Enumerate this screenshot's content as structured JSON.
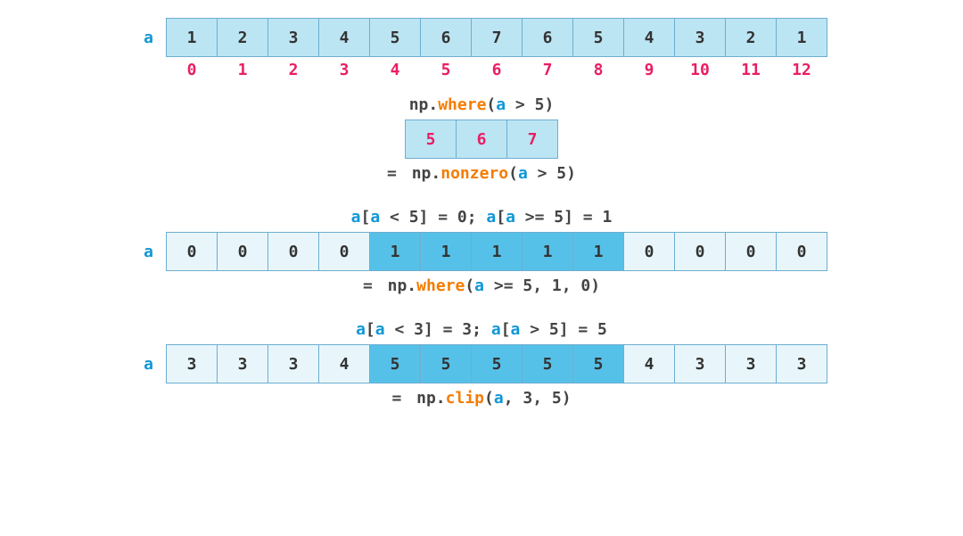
{
  "chart_data": [
    {
      "type": "table",
      "name": "numpy-where-single-arg",
      "title": "np.where(a > 5)",
      "equivalent": "= np.nonzero(a > 5)",
      "input_array": [
        1,
        2,
        3,
        4,
        5,
        6,
        7,
        6,
        5,
        4,
        3,
        2,
        1
      ],
      "indices": [
        0,
        1,
        2,
        3,
        4,
        5,
        6,
        7,
        8,
        9,
        10,
        11,
        12
      ],
      "result_indices": [
        5,
        6,
        7
      ]
    },
    {
      "type": "table",
      "name": "numpy-where-three-arg",
      "title": "a[a < 5] = 0; a[a >= 5] = 1",
      "equivalent": "= np.where(a >= 5, 1, 0)",
      "result_values": [
        0,
        0,
        0,
        0,
        1,
        1,
        1,
        1,
        1,
        0,
        0,
        0,
        0
      ]
    },
    {
      "type": "table",
      "name": "numpy-clip",
      "title": "a[a < 3] = 3; a[a > 5] = 5",
      "equivalent": "= np.clip(a, 3, 5)",
      "result_values": [
        3,
        3,
        3,
        4,
        5,
        5,
        5,
        5,
        5,
        4,
        3,
        3,
        3
      ]
    }
  ],
  "labels": {
    "a": "a"
  },
  "section1": {
    "arr": {
      "v0": "1",
      "v1": "2",
      "v2": "3",
      "v3": "4",
      "v4": "5",
      "v5": "6",
      "v6": "7",
      "v7": "6",
      "v8": "5",
      "v9": "4",
      "v10": "3",
      "v11": "2",
      "v12": "1"
    },
    "idx": {
      "i0": "0",
      "i1": "1",
      "i2": "2",
      "i3": "3",
      "i4": "4",
      "i5": "5",
      "i6": "6",
      "i7": "7",
      "i8": "8",
      "i9": "9",
      "i10": "10",
      "i11": "11",
      "i12": "12"
    },
    "code1": {
      "np": "np.",
      "fn": "where",
      "paren_open": "(",
      "var": "a",
      "rest": " > 5)"
    },
    "result": {
      "r0": "5",
      "r1": "6",
      "r2": "7"
    },
    "code2": {
      "eq": "= ",
      "np": "np.",
      "fn": "nonzero",
      "paren_open": "(",
      "var": "a",
      "rest": " > 5)"
    }
  },
  "section2": {
    "code1": {
      "v1": "a",
      "t1": "[",
      "v2": "a",
      "t2": " < 5] = 0; ",
      "v3": "a",
      "t3": "[",
      "v4": "a",
      "t4": " >= 5] = 1"
    },
    "arr": {
      "v0": "0",
      "v1": "0",
      "v2": "0",
      "v3": "0",
      "v4": "1",
      "v5": "1",
      "v6": "1",
      "v7": "1",
      "v8": "1",
      "v9": "0",
      "v10": "0",
      "v11": "0",
      "v12": "0"
    },
    "code2": {
      "eq": "= ",
      "np": "np.",
      "fn": "where",
      "paren_open": "(",
      "var": "a",
      "rest": " >= 5, 1, 0)"
    }
  },
  "section3": {
    "code1": {
      "v1": "a",
      "t1": "[",
      "v2": "a",
      "t2": " < 3] = 3; ",
      "v3": "a",
      "t3": "[",
      "v4": "a",
      "t4": " > 5] = 5"
    },
    "arr": {
      "v0": "3",
      "v1": "3",
      "v2": "3",
      "v3": "4",
      "v4": "5",
      "v5": "5",
      "v6": "5",
      "v7": "5",
      "v8": "5",
      "v9": "4",
      "v10": "3",
      "v11": "3",
      "v12": "3"
    },
    "code2": {
      "eq": "= ",
      "np": "np.",
      "fn": "clip",
      "paren_open": "(",
      "var": "a",
      "rest": ", 3, 5)"
    }
  }
}
